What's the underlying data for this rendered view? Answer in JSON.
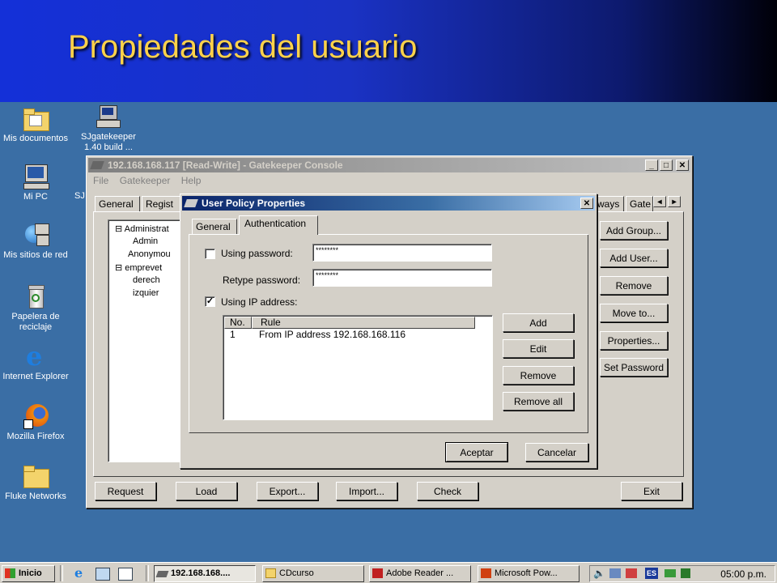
{
  "slide": {
    "title": "Propiedades del usuario"
  },
  "desktop_icons": [
    {
      "label": "Mis documentos",
      "icon": "folder-docs-icon"
    },
    {
      "label": "SJgatekeeper 1.40 build ...",
      "icon": "program-icon"
    },
    {
      "label": "Mi PC",
      "icon": "computer-icon"
    },
    {
      "label": "SJ",
      "icon": "program-icon"
    },
    {
      "label": "Mis sitios de red",
      "icon": "network-icon"
    },
    {
      "label": "Papelera de reciclaje",
      "icon": "recycle-bin-icon"
    },
    {
      "label": "Internet Explorer",
      "icon": "ie-icon"
    },
    {
      "label": "Mozilla Firefox",
      "icon": "firefox-icon"
    },
    {
      "label": "Fluke Networks",
      "icon": "folder-icon"
    }
  ],
  "console": {
    "title": "192.168.168.117 [Read-Write] - Gatekeeper Console",
    "menu": [
      "File",
      "Gatekeeper",
      "Help"
    ],
    "tabs": [
      "General",
      "Regist",
      "ways",
      "Gate"
    ],
    "tree": [
      "Administrat",
      "Admin",
      "Anonymou",
      "emprevet",
      "derech",
      "izquier"
    ],
    "side_buttons": [
      "Add Group...",
      "Add User...",
      "Remove",
      "Move to...",
      "Properties...",
      "Set Password"
    ],
    "bottom_buttons": [
      "Request",
      "Load",
      "Export...",
      "Import...",
      "Check",
      "Exit"
    ]
  },
  "dialog": {
    "title": "User Policy Properties",
    "tabs": [
      "General",
      "Authentication"
    ],
    "active_tab": "Authentication",
    "using_password_label": "Using password:",
    "using_password_checked": false,
    "password_value": "********",
    "retype_label": "Retype password:",
    "retype_value": "********",
    "using_ip_label": "Using IP address:",
    "using_ip_checked": true,
    "rules_columns": [
      "No.",
      "Rule"
    ],
    "rules": [
      {
        "no": "1",
        "rule": "From IP address 192.168.168.116"
      }
    ],
    "rule_buttons": [
      "Add",
      "Edit",
      "Remove",
      "Remove all"
    ],
    "ok_label": "Aceptar",
    "cancel_label": "Cancelar"
  },
  "taskbar": {
    "start_label": "Inicio",
    "items": [
      "192.168.168....",
      "CDcurso",
      "Adobe Reader ...",
      "Microsoft Pow..."
    ],
    "lang": "ES",
    "clock": "05:00 p.m."
  },
  "colors": {
    "title": "#ffd24a",
    "desktop": "#3a6ea5",
    "header": "#1430d8"
  }
}
